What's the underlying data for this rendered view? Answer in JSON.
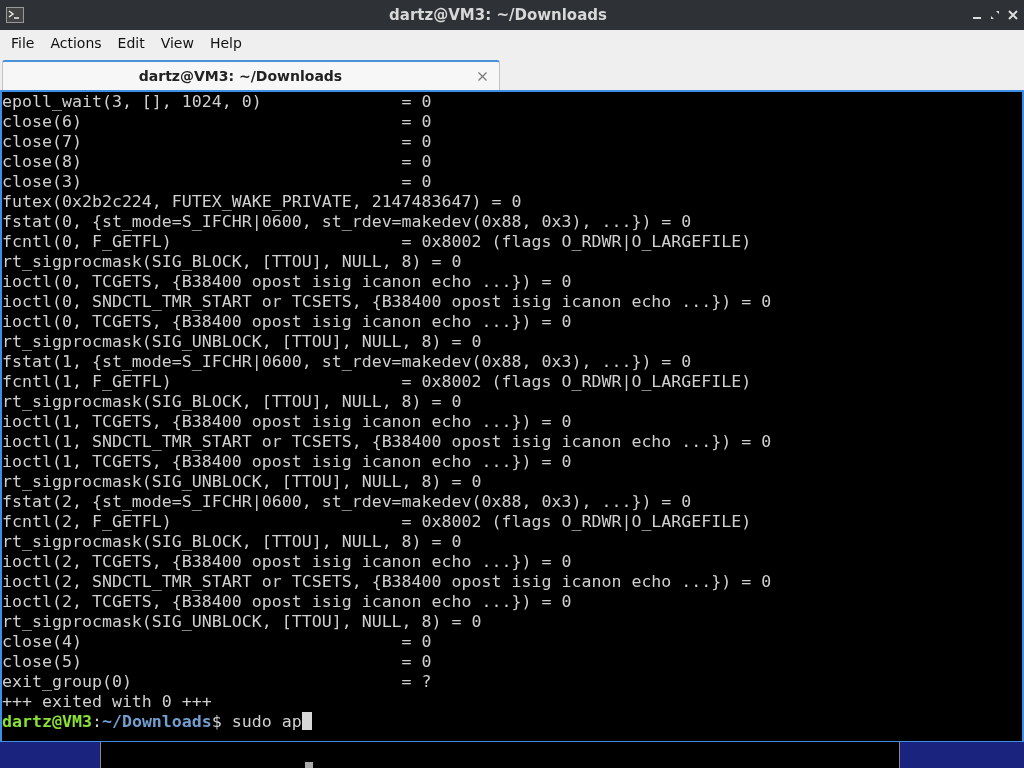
{
  "window": {
    "title": "dartz@VM3: ~/Downloads"
  },
  "menu": [
    "File",
    "Actions",
    "Edit",
    "View",
    "Help"
  ],
  "tabs": [
    {
      "label": "dartz@VM3: ~/Downloads",
      "selected": true
    }
  ],
  "terminal": {
    "lines": [
      "epoll_wait(3, [], 1024, 0)              = 0",
      "close(6)                                = 0",
      "close(7)                                = 0",
      "close(8)                                = 0",
      "close(3)                                = 0",
      "futex(0x2b2c224, FUTEX_WAKE_PRIVATE, 2147483647) = 0",
      "fstat(0, {st_mode=S_IFCHR|0600, st_rdev=makedev(0x88, 0x3), ...}) = 0",
      "fcntl(0, F_GETFL)                       = 0x8002 (flags O_RDWR|O_LARGEFILE)",
      "rt_sigprocmask(SIG_BLOCK, [TTOU], NULL, 8) = 0",
      "ioctl(0, TCGETS, {B38400 opost isig icanon echo ...}) = 0",
      "ioctl(0, SNDCTL_TMR_START or TCSETS, {B38400 opost isig icanon echo ...}) = 0",
      "ioctl(0, TCGETS, {B38400 opost isig icanon echo ...}) = 0",
      "rt_sigprocmask(SIG_UNBLOCK, [TTOU], NULL, 8) = 0",
      "fstat(1, {st_mode=S_IFCHR|0600, st_rdev=makedev(0x88, 0x3), ...}) = 0",
      "fcntl(1, F_GETFL)                       = 0x8002 (flags O_RDWR|O_LARGEFILE)",
      "rt_sigprocmask(SIG_BLOCK, [TTOU], NULL, 8) = 0",
      "ioctl(1, TCGETS, {B38400 opost isig icanon echo ...}) = 0",
      "ioctl(1, SNDCTL_TMR_START or TCSETS, {B38400 opost isig icanon echo ...}) = 0",
      "ioctl(1, TCGETS, {B38400 opost isig icanon echo ...}) = 0",
      "rt_sigprocmask(SIG_UNBLOCK, [TTOU], NULL, 8) = 0",
      "fstat(2, {st_mode=S_IFCHR|0600, st_rdev=makedev(0x88, 0x3), ...}) = 0",
      "fcntl(2, F_GETFL)                       = 0x8002 (flags O_RDWR|O_LARGEFILE)",
      "rt_sigprocmask(SIG_BLOCK, [TTOU], NULL, 8) = 0",
      "ioctl(2, TCGETS, {B38400 opost isig icanon echo ...}) = 0",
      "ioctl(2, SNDCTL_TMR_START or TCSETS, {B38400 opost isig icanon echo ...}) = 0",
      "ioctl(2, TCGETS, {B38400 opost isig icanon echo ...}) = 0",
      "rt_sigprocmask(SIG_UNBLOCK, [TTOU], NULL, 8) = 0",
      "close(4)                                = 0",
      "close(5)                                = 0",
      "exit_group(0)                           = ?",
      "+++ exited with 0 +++"
    ],
    "prompt": {
      "user_host": "dartz@VM3",
      "separator": ":",
      "path": "~/Downloads",
      "command": "$ sudo ap"
    }
  }
}
